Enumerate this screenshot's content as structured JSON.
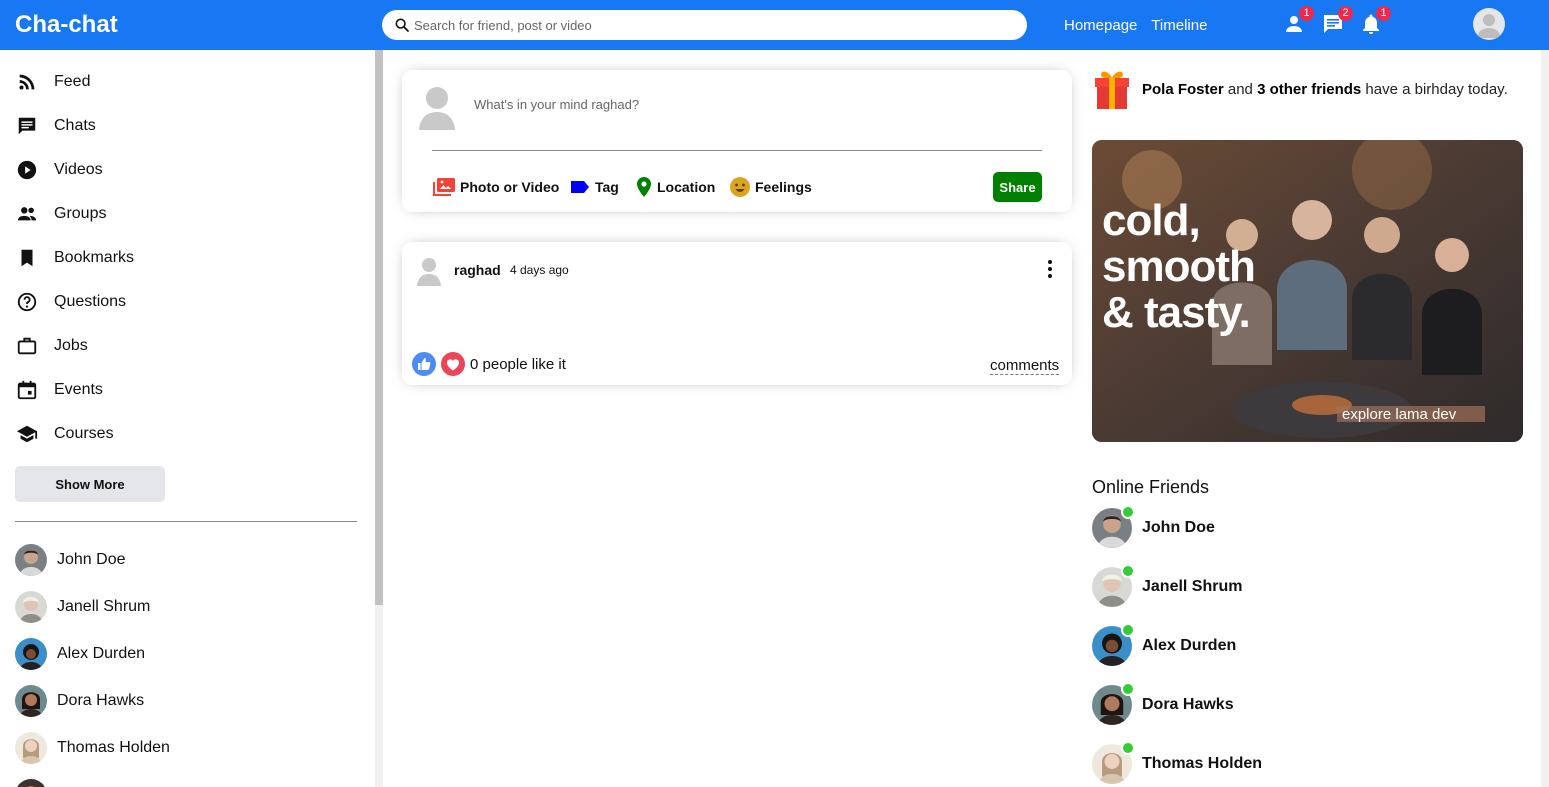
{
  "topbar": {
    "logo": "Cha-chat",
    "search_placeholder": "Search for friend, post or video",
    "links": [
      "Homepage",
      "Timeline"
    ],
    "icons": [
      {
        "name": "person-icon",
        "badge": "1"
      },
      {
        "name": "chat-icon",
        "badge": "2"
      },
      {
        "name": "notifications-icon",
        "badge": "1"
      }
    ],
    "accent_color": "#1877f2"
  },
  "sidebar": {
    "items": [
      {
        "label": "Feed",
        "icon": "rss-feed-icon"
      },
      {
        "label": "Chats",
        "icon": "chat-icon"
      },
      {
        "label": "Videos",
        "icon": "play-circle-icon"
      },
      {
        "label": "Groups",
        "icon": "group-icon"
      },
      {
        "label": "Bookmarks",
        "icon": "bookmark-icon"
      },
      {
        "label": "Questions",
        "icon": "help-outline-icon"
      },
      {
        "label": "Jobs",
        "icon": "work-outline-icon"
      },
      {
        "label": "Events",
        "icon": "event-icon"
      },
      {
        "label": "Courses",
        "icon": "school-icon"
      }
    ],
    "show_more_label": "Show More",
    "friends": [
      "John Doe",
      "Janell Shrum",
      "Alex Durden",
      "Dora Hawks",
      "Thomas Holden"
    ]
  },
  "share": {
    "placeholder": "What's in your mind raghad?",
    "options": [
      {
        "label": "Photo or Video",
        "icon": "perm-media-icon",
        "color": "#f44336"
      },
      {
        "label": "Tag",
        "icon": "label-icon",
        "color": "#0000ff"
      },
      {
        "label": "Location",
        "icon": "room-icon",
        "color": "#008000"
      },
      {
        "label": "Feelings",
        "icon": "emoji-emotions-icon",
        "color": "#daa520"
      }
    ],
    "button_label": "Share",
    "button_color": "#008000"
  },
  "post": {
    "username": "raghad",
    "date": "4 days ago",
    "likes_text": "0 people like it",
    "comments_label": "comments"
  },
  "rightbar": {
    "birthday": {
      "name": "Pola Foster",
      "joiner": "and",
      "others": "3 other friends",
      "suffix": "have a birhday today."
    },
    "ad": {
      "headline_lines": [
        "cold,",
        "smooth",
        "& tasty."
      ],
      "footer": "explore lama dev"
    },
    "online_title": "Online Friends",
    "online_friends": [
      "John Doe",
      "Janell Shrum",
      "Alex Durden",
      "Dora Hawks",
      "Thomas Holden"
    ],
    "online_color": "#32cd32"
  }
}
